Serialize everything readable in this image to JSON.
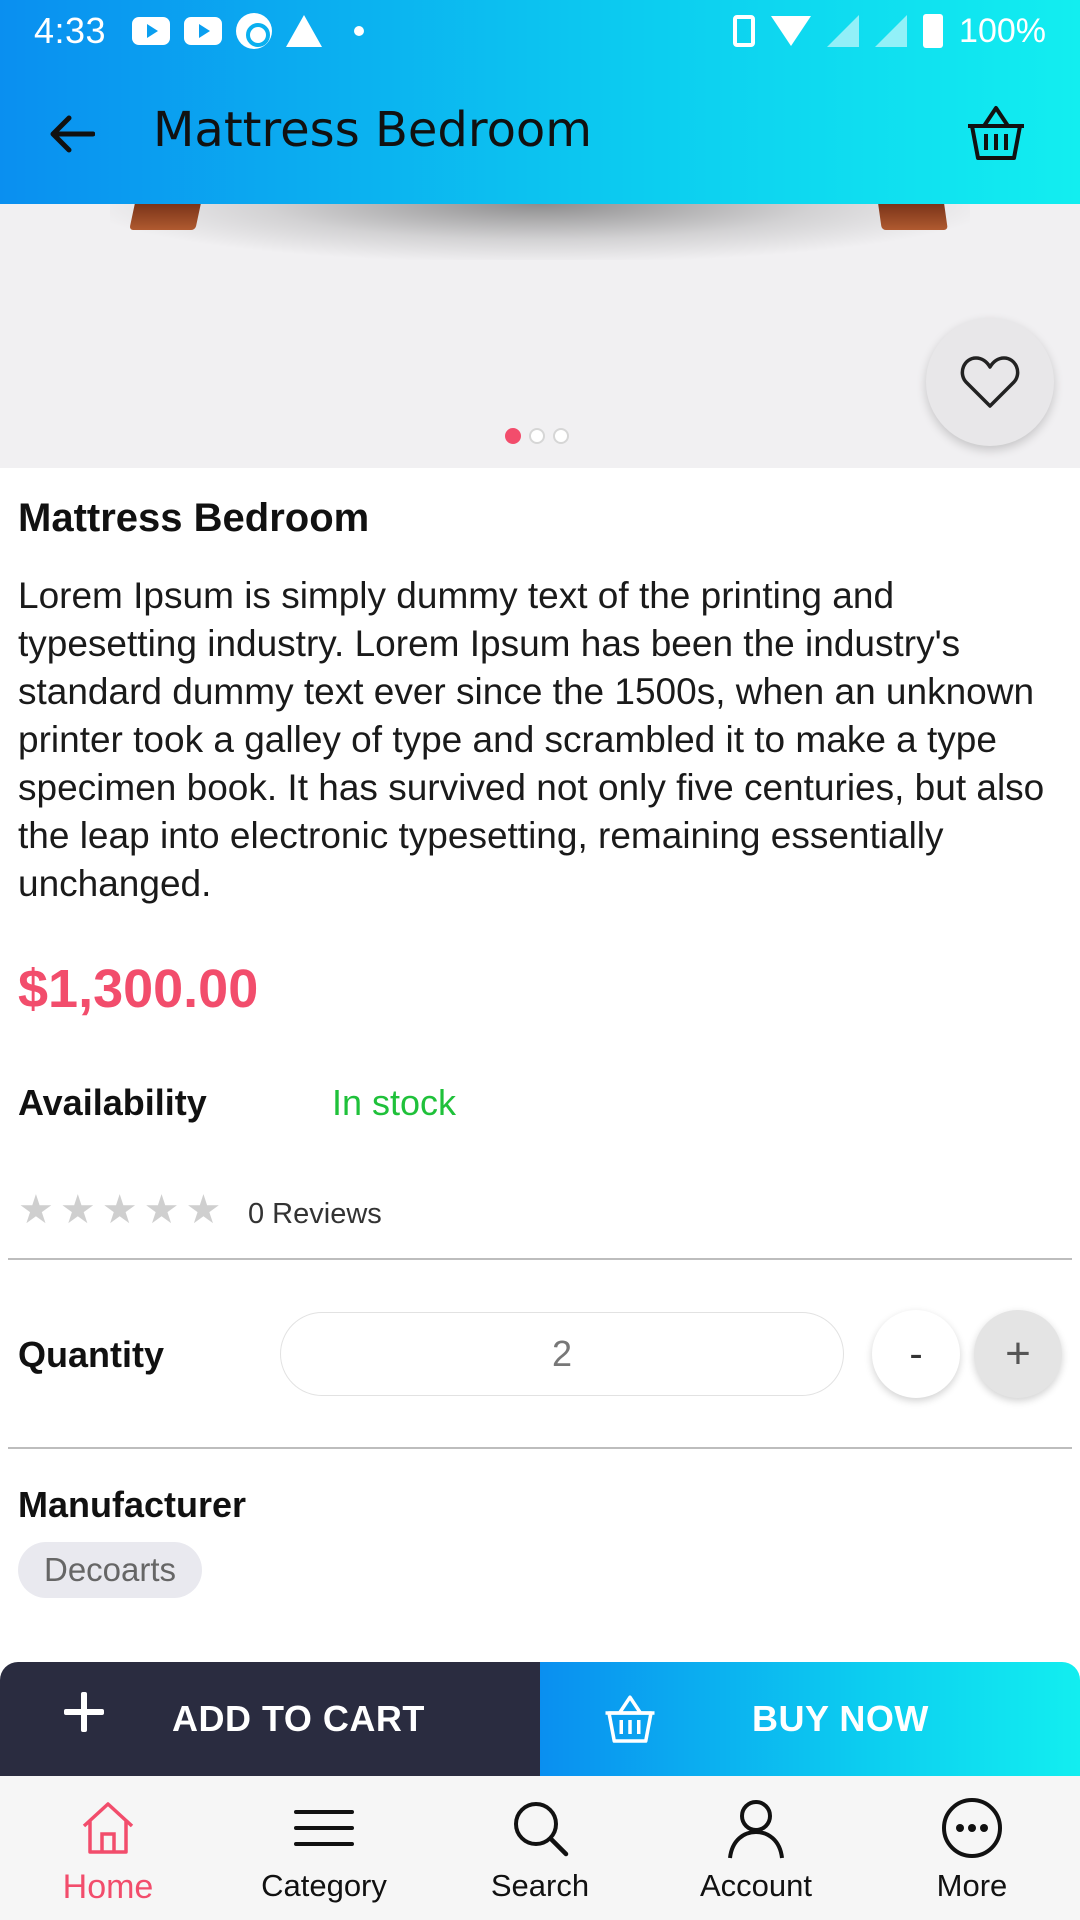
{
  "status_bar": {
    "time": "4:33",
    "battery": "100%",
    "icons": [
      "youtube-icon",
      "youtube-icon",
      "sync-icon",
      "warning-icon",
      "dot-icon",
      "vibrate-icon",
      "wifi-icon",
      "signal-icon",
      "signal-icon",
      "battery-icon"
    ]
  },
  "app_bar": {
    "title": "Mattress Bedroom",
    "back_icon": "arrow-left-icon",
    "cart_icon": "basket-icon"
  },
  "gallery": {
    "page_count": 3,
    "active_index": 0
  },
  "product": {
    "name": "Mattress Bedroom",
    "description": "Lorem Ipsum is simply dummy text of the printing and typesetting industry. Lorem Ipsum has been the industry's standard dummy text ever since the 1500s, when an unknown printer took a galley of type and scrambled it to make a type specimen book. It has survived not only five centuries, but also the leap into electronic typesetting, remaining essentially unchanged.",
    "price": "$1,300.00",
    "availability_label": "Availability",
    "availability_value": "In stock",
    "rating": 0,
    "rating_max": 5,
    "reviews": "0 Reviews",
    "quantity_label": "Quantity",
    "quantity": "2",
    "minus_label": "-",
    "plus_label": "+",
    "manufacturer_label": "Manufacturer",
    "manufacturer": "Decoarts"
  },
  "actions": {
    "add_to_cart": "ADD TO CART",
    "buy_now": "BUY NOW"
  },
  "bottom_nav": [
    {
      "label": "Home",
      "icon": "home-icon",
      "active": true
    },
    {
      "label": "Category",
      "icon": "menu-icon",
      "active": false
    },
    {
      "label": "Search",
      "icon": "search-icon",
      "active": false
    },
    {
      "label": "Account",
      "icon": "user-icon",
      "active": false
    },
    {
      "label": "More",
      "icon": "more-icon",
      "active": false
    }
  ],
  "colors": {
    "accent": "#f24d6c",
    "in_stock": "#1fc13a",
    "gradient_start": "#0a8ff0",
    "gradient_end": "#12eef0",
    "dark_button": "#2a2c40"
  }
}
